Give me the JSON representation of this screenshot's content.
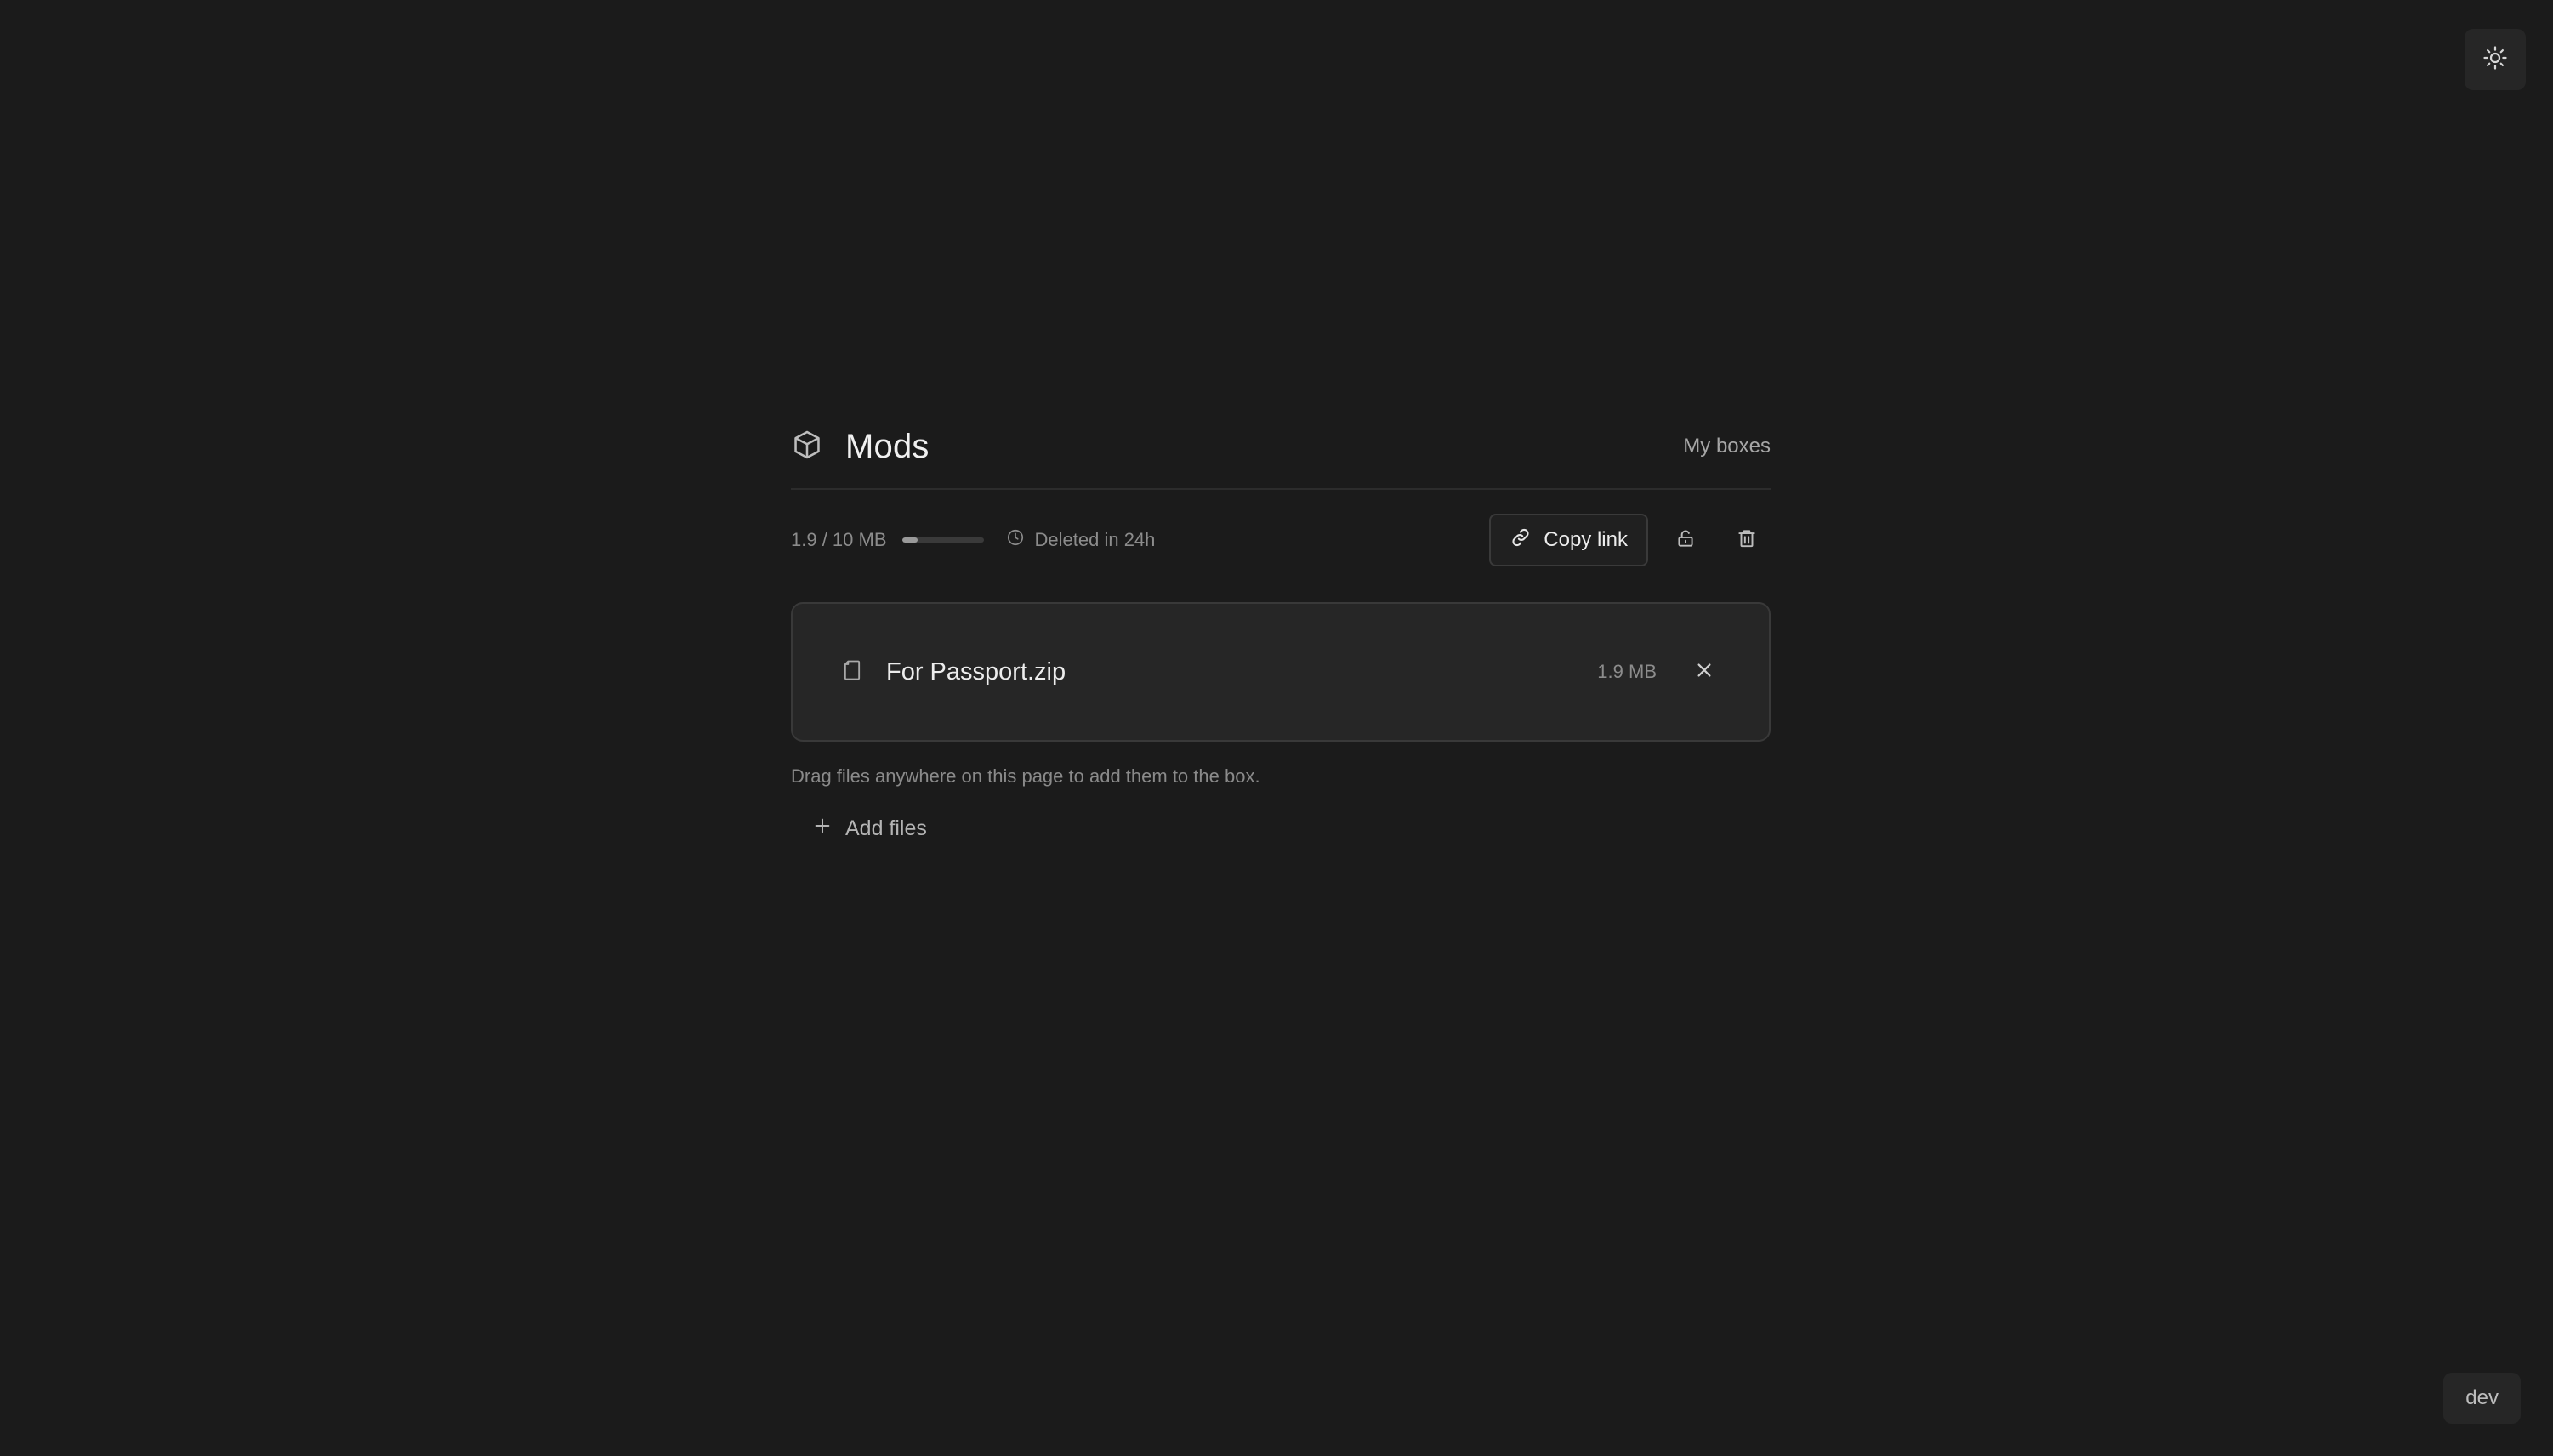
{
  "box": {
    "title": "Mods",
    "nav_link": "My boxes",
    "icon": "package-icon"
  },
  "usage": {
    "label": "1.9 / 10 MB",
    "used_mb": 1.9,
    "limit_mb": 10,
    "fraction": 0.19
  },
  "expiry": {
    "label": "Deleted in 24h",
    "icon": "clock-icon"
  },
  "actions": {
    "copy_link_label": "Copy link",
    "copy_link_icon": "link-icon",
    "lock_icon": "lock-open-icon",
    "delete_icon": "trash-icon"
  },
  "files": [
    {
      "name": "For Passport.zip",
      "size": "1.9 MB",
      "icon": "file-icon"
    }
  ],
  "hint": "Drag files anywhere on this page to add them to the box.",
  "add_files_label": "Add files",
  "theme_toggle_icon": "sun-icon",
  "env_badge": "dev",
  "colors": {
    "background": "#1b1b1b",
    "card": "#262626",
    "muted_text": "#8c8c8c"
  }
}
